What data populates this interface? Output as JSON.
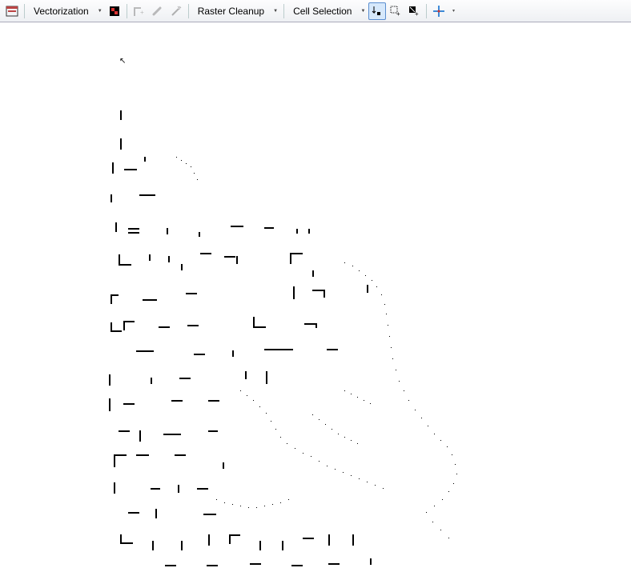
{
  "toolbar": {
    "vectorization_label": "Vectorization",
    "raster_cleanup_label": "Raster Cleanup",
    "cell_selection_label": "Cell Selection",
    "icons": {
      "layer_target": "layer-target-icon",
      "raster_painting": "raster-painting-icon",
      "vector_trace": "vector-trace-icon",
      "raster_erase": "raster-erase-icon",
      "magic_erase": "magic-erase-icon",
      "select_cells": "select-connected-cells-icon",
      "select_cells_ext": "select-cells-extent-icon",
      "clear_selection": "clear-selection-icon",
      "snap": "raster-snapping-icon",
      "toolbar_options": "toolbar-options-icon"
    }
  },
  "canvas": {
    "description": "Sparse noisy raster fragments — partial vectorization output",
    "cursor": "arrow"
  }
}
